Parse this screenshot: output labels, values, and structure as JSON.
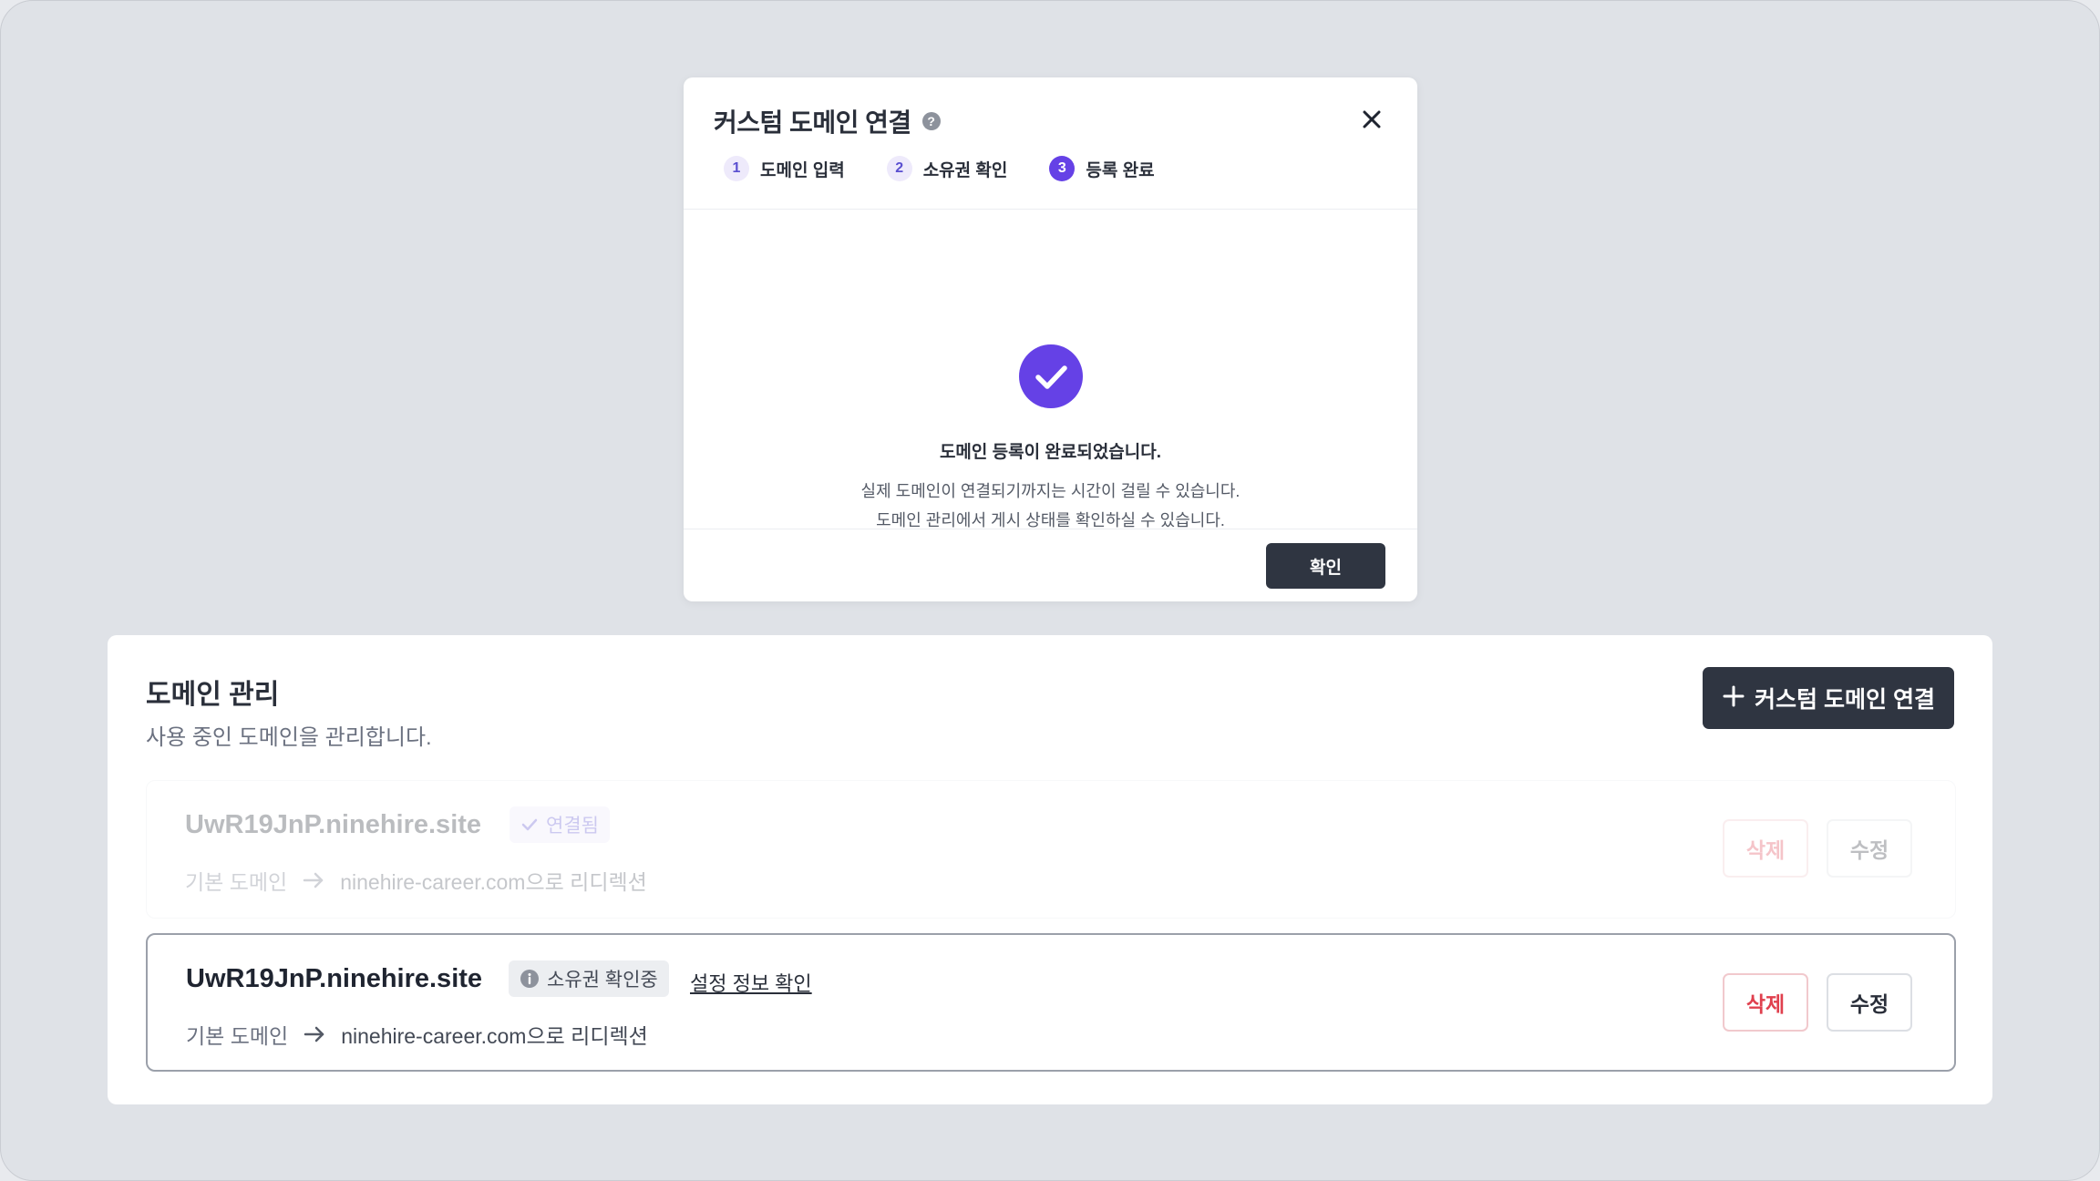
{
  "modal": {
    "title": "커스텀 도메인 연결",
    "help_icon": "?",
    "steps": [
      {
        "num": "1",
        "label": "도메인 입력"
      },
      {
        "num": "2",
        "label": "소유권 확인"
      },
      {
        "num": "3",
        "label": "등록 완료"
      }
    ],
    "active_step": 3,
    "success_title": "도메인 등록이 완료되었습니다.",
    "success_desc_line1": "실제 도메인이 연결되기까지는 시간이 걸릴 수 있습니다.",
    "success_desc_line2": "도메인 관리에서 게시 상태를 확인하실 수 있습니다.",
    "confirm_label": "확인"
  },
  "panel": {
    "title": "도메인 관리",
    "subtitle": "사용 중인 도메인을 관리합니다.",
    "add_button_label": "커스텀 도메인 연결",
    "domains": [
      {
        "name": "UwR19JnP.ninehire.site",
        "status": "연결됨",
        "base_label": "기본 도메인",
        "target": "ninehire-career.com으로 리디렉션",
        "delete_label": "삭제",
        "edit_label": "수정"
      },
      {
        "name": "UwR19JnP.ninehire.site",
        "status": "소유권 확인중",
        "settings_link": "설정 정보 확인",
        "base_label": "기본 도메인",
        "target": "ninehire-career.com으로 리디렉션",
        "delete_label": "삭제",
        "edit_label": "수정"
      }
    ]
  },
  "colors": {
    "accent": "#6541e6",
    "dark_button": "#2f3541",
    "danger": "#e0404e",
    "background": "#dfe2e7"
  },
  "icons": {
    "close": "close-icon",
    "help": "help-icon",
    "check": "check-icon",
    "info": "info-icon",
    "arrow": "arrow-right-icon",
    "plus": "plus-icon"
  }
}
